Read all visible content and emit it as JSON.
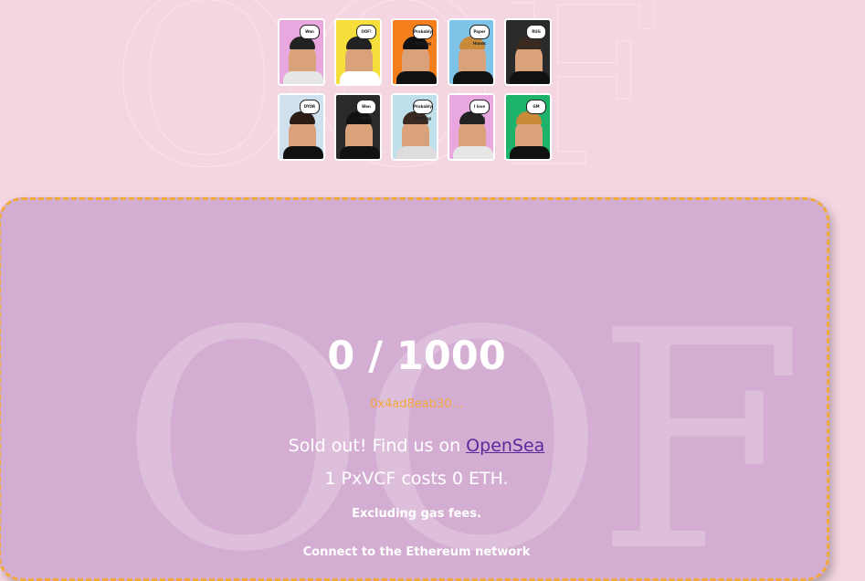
{
  "background_text": "OOF",
  "cards": [
    {
      "bubble": "Wen Mint",
      "bg": "#e9a7e0",
      "shirt": "#e6e6e6",
      "hair": "#222"
    },
    {
      "bubble": "OOF!",
      "bg": "#f6df3a",
      "shirt": "#ffffff",
      "hair": "#222"
    },
    {
      "bubble": "Probably Nothing",
      "bg": "#f57f1c",
      "shirt": "#111",
      "hair": "#111"
    },
    {
      "bubble": "Paper Hands",
      "bg": "#7ec4e8",
      "shirt": "#111",
      "hair": "#c98a3a"
    },
    {
      "bubble": "RUG",
      "bg": "#2a2a2a",
      "shirt": "#111",
      "hair": "#3b2a22"
    },
    {
      "bubble": "DYOR",
      "bg": "#cfe0ee",
      "shirt": "#111",
      "hair": "#2b1d16"
    },
    {
      "bubble": "Wen Moon",
      "bg": "#2a2a2a",
      "shirt": "#111",
      "hair": "#111"
    },
    {
      "bubble": "Probably Nothing",
      "bg": "#bfe0ea",
      "shirt": "#ddd",
      "hair": "#3b2a22"
    },
    {
      "bubble": "I love bears",
      "bg": "#e9a7e0",
      "shirt": "#e6e6e6",
      "hair": "#222"
    },
    {
      "bubble": "GM",
      "bg": "#1db36b",
      "shirt": "#111",
      "hair": "#c98a3a"
    }
  ],
  "mint": {
    "count": "0 / 1000",
    "address": "0x4ad8eab30...",
    "soldout_prefix": "Sold out! Find us on ",
    "opensea_link": "OpenSea",
    "cost_text": "1 PxVCF costs 0 ETH.",
    "gas_text": "Excluding gas fees.",
    "connect_text": "Connect to the Ethereum network"
  }
}
